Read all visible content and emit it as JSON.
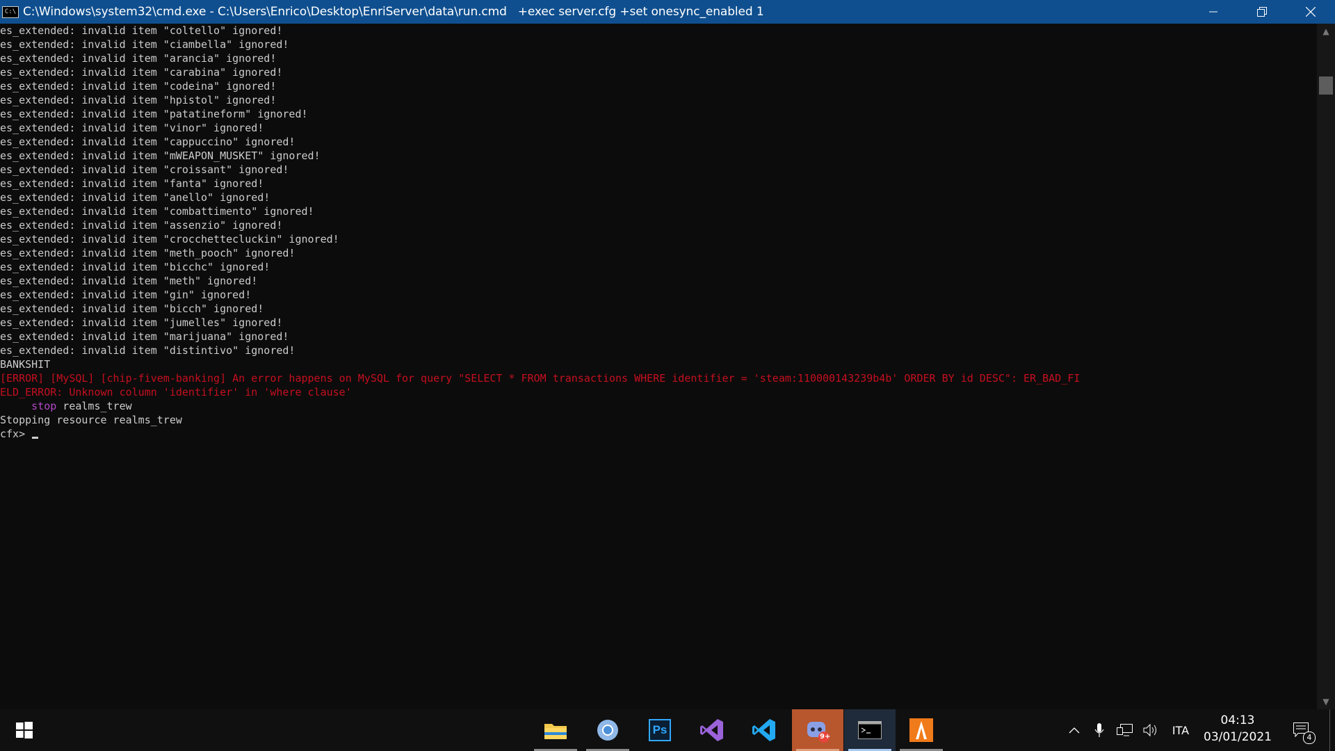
{
  "window": {
    "title": "C:\\Windows\\system32\\cmd.exe - C:\\Users\\Enrico\\Desktop\\EnriServer\\data\\run.cmd   +exec server.cfg +set onesync_enabled 1",
    "icon_text": "C:\\"
  },
  "console": {
    "lines": [
      "es_extended: invalid item \"coltello\" ignored!",
      "es_extended: invalid item \"ciambella\" ignored!",
      "es_extended: invalid item \"arancia\" ignored!",
      "es_extended: invalid item \"carabina\" ignored!",
      "es_extended: invalid item \"codeina\" ignored!",
      "es_extended: invalid item \"hpistol\" ignored!",
      "es_extended: invalid item \"patatineform\" ignored!",
      "es_extended: invalid item \"vinor\" ignored!",
      "es_extended: invalid item \"cappuccino\" ignored!",
      "es_extended: invalid item \"mWEAPON_MUSKET\" ignored!",
      "es_extended: invalid item \"croissant\" ignored!",
      "es_extended: invalid item \"fanta\" ignored!",
      "es_extended: invalid item \"anello\" ignored!",
      "es_extended: invalid item \"combattimento\" ignored!",
      "es_extended: invalid item \"assenzio\" ignored!",
      "es_extended: invalid item \"crocchettecluckin\" ignored!",
      "es_extended: invalid item \"meth_pooch\" ignored!",
      "es_extended: invalid item \"bicchc\" ignored!",
      "es_extended: invalid item \"meth\" ignored!",
      "es_extended: invalid item \"gin\" ignored!",
      "es_extended: invalid item \"bicch\" ignored!",
      "es_extended: invalid item \"jumelles\" ignored!",
      "es_extended: invalid item \"marijuana\" ignored!",
      "es_extended: invalid item \"distintivo\" ignored!",
      "BANKSHIT"
    ],
    "error_line_1": "[ERROR] [MySQL] [chip-fivem-banking] An error happens on MySQL for query \"SELECT * FROM transactions WHERE identifier = 'steam:110000143239b4b' ORDER BY id DESC\": ER_BAD_FI",
    "error_line_2": "ELD_ERROR: Unknown column 'identifier' in 'where clause'",
    "cmd_keyword": "stop",
    "cmd_arg": " realms_trew",
    "stopping_line": "Stopping resource realms_trew",
    "prompt": "cfx> ",
    "colors": {
      "error": "#c50f1f",
      "command": "#b148c6",
      "text": "#cccccc"
    }
  },
  "taskbar": {
    "apps": [
      {
        "name": "file-explorer-icon",
        "running": true
      },
      {
        "name": "chrome-icon",
        "running": true
      },
      {
        "name": "photoshop-icon",
        "label": "Ps",
        "running": false
      },
      {
        "name": "visual-studio-icon",
        "running": false
      },
      {
        "name": "vscode-icon",
        "running": false
      },
      {
        "name": "discord-icon",
        "badge": "9+",
        "running": true,
        "highlighted": true
      },
      {
        "name": "cmd-icon",
        "running": true,
        "active": true
      },
      {
        "name": "app-orange-icon",
        "running": true
      }
    ],
    "tray": {
      "language": "ITA",
      "time": "04:13",
      "date": "03/01/2021",
      "notifications_count": "4"
    }
  }
}
